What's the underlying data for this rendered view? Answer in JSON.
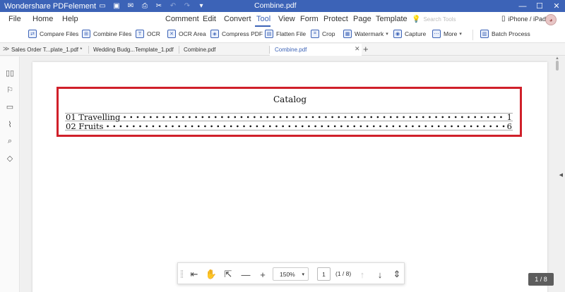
{
  "app": {
    "name": "Wondershare PDFelement",
    "document_title": "Combine.pdf"
  },
  "window_controls": {
    "minimize": "—",
    "maximize": "☐",
    "close": "✕"
  },
  "menu": {
    "items": [
      "File",
      "Home",
      "Help",
      "Comment",
      "Edit",
      "Convert",
      "Tool",
      "View",
      "Form",
      "Protect",
      "Page",
      "Template"
    ],
    "active": "Tool",
    "search_placeholder": "Search Tools",
    "device_label": "iPhone / iPad"
  },
  "toolbar": {
    "tools": [
      {
        "label": "Compare Files",
        "icon": "compare-files-icon"
      },
      {
        "label": "Combine Files",
        "icon": "combine-files-icon"
      },
      {
        "label": "OCR",
        "icon": "ocr-icon"
      },
      {
        "label": "OCR Area",
        "icon": "ocr-area-icon"
      },
      {
        "label": "Compress PDF",
        "icon": "compress-pdf-icon"
      },
      {
        "label": "Flatten File",
        "icon": "flatten-file-icon"
      },
      {
        "label": "Crop",
        "icon": "crop-icon"
      },
      {
        "label": "Watermark",
        "icon": "watermark-icon"
      },
      {
        "label": "Capture",
        "icon": "capture-icon"
      },
      {
        "label": "More",
        "icon": "more-icon"
      },
      {
        "label": "Batch Process",
        "icon": "batch-process-icon"
      }
    ]
  },
  "tabs": [
    {
      "label": "Sales Order T...plate_1.pdf *",
      "active": false
    },
    {
      "label": "Wedding Budg...Template_1.pdf",
      "active": false
    },
    {
      "label": "Combine.pdf",
      "active": false
    },
    {
      "label": "Combine.pdf",
      "active": true
    }
  ],
  "document": {
    "catalog_title": "Catalog",
    "toc": [
      {
        "label": "01 Travelling",
        "page": "1"
      },
      {
        "label": "02 Fruits",
        "page": "6"
      }
    ]
  },
  "bottom_bar": {
    "zoom": "150%",
    "current_page": "1",
    "page_count": "(1 / 8)"
  },
  "page_indicator": "1 / 8",
  "colors": {
    "brand": "#3c63b7",
    "highlight": "#d0202a"
  }
}
